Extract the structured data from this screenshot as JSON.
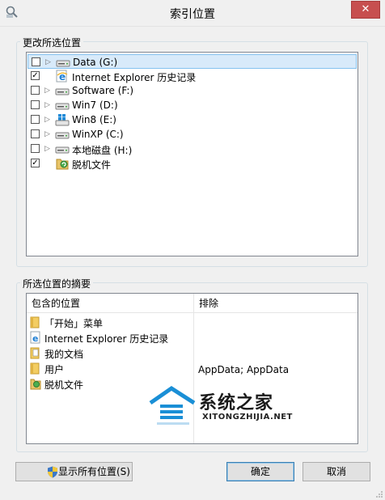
{
  "window": {
    "title": "索引位置",
    "close_label": "✕"
  },
  "locations_group": {
    "label": "更改所选位置",
    "items": [
      {
        "label": "Data (G:)",
        "checked": false,
        "icon": "drive-icon",
        "expandable": true,
        "selected": true
      },
      {
        "label": "Internet Explorer 历史记录",
        "checked": true,
        "icon": "ie-icon",
        "expandable": false,
        "selected": false
      },
      {
        "label": "Software (F:)",
        "checked": false,
        "icon": "drive-icon",
        "expandable": true,
        "selected": false
      },
      {
        "label": "Win7 (D:)",
        "checked": false,
        "icon": "drive-icon",
        "expandable": true,
        "selected": false
      },
      {
        "label": "Win8 (E:)",
        "checked": false,
        "icon": "windows-drive-icon",
        "expandable": true,
        "selected": false
      },
      {
        "label": "WinXP (C:)",
        "checked": false,
        "icon": "drive-icon",
        "expandable": true,
        "selected": false
      },
      {
        "label": "本地磁盘 (H:)",
        "checked": false,
        "icon": "drive-icon",
        "expandable": true,
        "selected": false
      },
      {
        "label": "脱机文件",
        "checked": true,
        "icon": "offline-files-icon",
        "expandable": false,
        "selected": false
      }
    ]
  },
  "summary_group": {
    "label": "所选位置的摘要",
    "columns": {
      "included": "包含的位置",
      "excluded": "排除"
    },
    "rows": [
      {
        "label": "「开始」菜单",
        "icon": "folder-icon"
      },
      {
        "label": "Internet Explorer 历史记录",
        "icon": "ie-icon"
      },
      {
        "label": "我的文档",
        "icon": "documents-folder-icon"
      },
      {
        "label": "用户",
        "icon": "folder-icon"
      },
      {
        "label": "脱机文件",
        "icon": "offline-files-icon"
      }
    ],
    "excluded_value": "AppData; AppData"
  },
  "watermark": {
    "text": "系统之家",
    "subtext": "XITONGZHIJIA.NET"
  },
  "buttons": {
    "show_all": "显示所有位置(S)",
    "ok": "确定",
    "cancel": "取消"
  },
  "colors": {
    "accent": "#3c7fb1",
    "selection": "#d8eafa",
    "close": "#c74f4f"
  }
}
